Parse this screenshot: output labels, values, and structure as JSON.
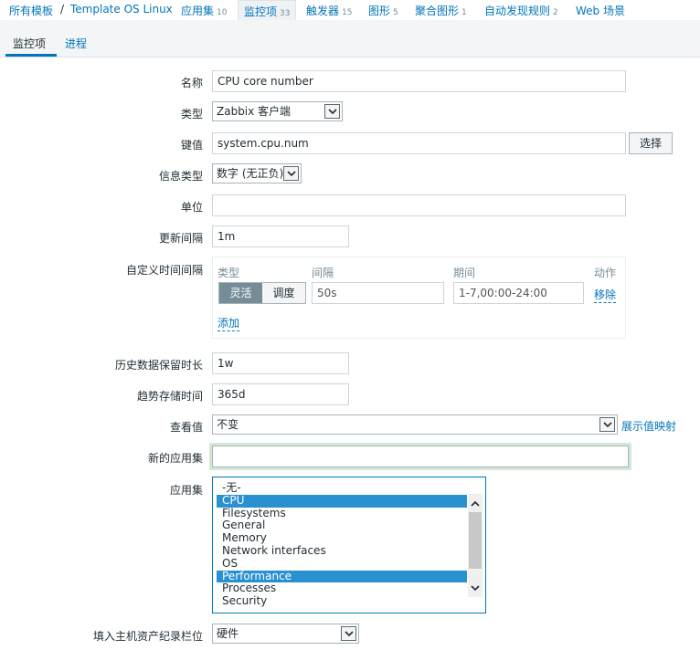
{
  "breadcrumb": {
    "all_templates": "所有模板",
    "separator": "/",
    "template_name": "Template OS Linux",
    "tabs": [
      {
        "label": "应用集",
        "count": "10"
      },
      {
        "label": "监控项",
        "count": "33"
      },
      {
        "label": "触发器",
        "count": "15"
      },
      {
        "label": "图形",
        "count": "5"
      },
      {
        "label": "聚合图形",
        "count": "1"
      },
      {
        "label": "自动发现规则",
        "count": "2"
      },
      {
        "label": "Web 场景",
        "count": ""
      }
    ]
  },
  "subtabs": [
    "监控项",
    "进程"
  ],
  "form": {
    "name": {
      "label": "名称",
      "value": "CPU core number"
    },
    "type": {
      "label": "类型",
      "value": "Zabbix 客户端"
    },
    "key": {
      "label": "键值",
      "value": "system.cpu.num",
      "button": "选择"
    },
    "info_type": {
      "label": "信息类型",
      "value": "数字 (无正负)"
    },
    "units": {
      "label": "单位",
      "value": ""
    },
    "update_interval": {
      "label": "更新间隔",
      "value": "1m"
    },
    "custom_intervals": {
      "label": "自定义时间间隔",
      "headers": {
        "type": "类型",
        "interval": "间隔",
        "period": "期间",
        "action": "动作"
      },
      "row": {
        "type_on": "灵活",
        "type_off": "调度",
        "interval": "50s",
        "period": "1-7,00:00-24:00",
        "remove": "移除"
      },
      "add": "添加"
    },
    "history": {
      "label": "历史数据保留时长",
      "value": "1w"
    },
    "trends": {
      "label": "趋势存储时间",
      "value": "365d"
    },
    "show_value": {
      "label": "查看值",
      "value": "不变",
      "link": "展示值映射"
    },
    "new_application": {
      "label": "新的应用集",
      "value": ""
    },
    "applications": {
      "label": "应用集",
      "options": [
        "-无-",
        "CPU",
        "Filesystems",
        "General",
        "Memory",
        "Network interfaces",
        "OS",
        "Performance",
        "Processes",
        "Security"
      ],
      "selected": [
        "CPU",
        "Performance"
      ]
    },
    "inventory": {
      "label": "填入主机资产纪录栏位",
      "value": "硬件"
    }
  },
  "colors": {
    "accent": "#0275b8",
    "selected_bg": "#2a91d0",
    "active_seg": "#768d99"
  }
}
